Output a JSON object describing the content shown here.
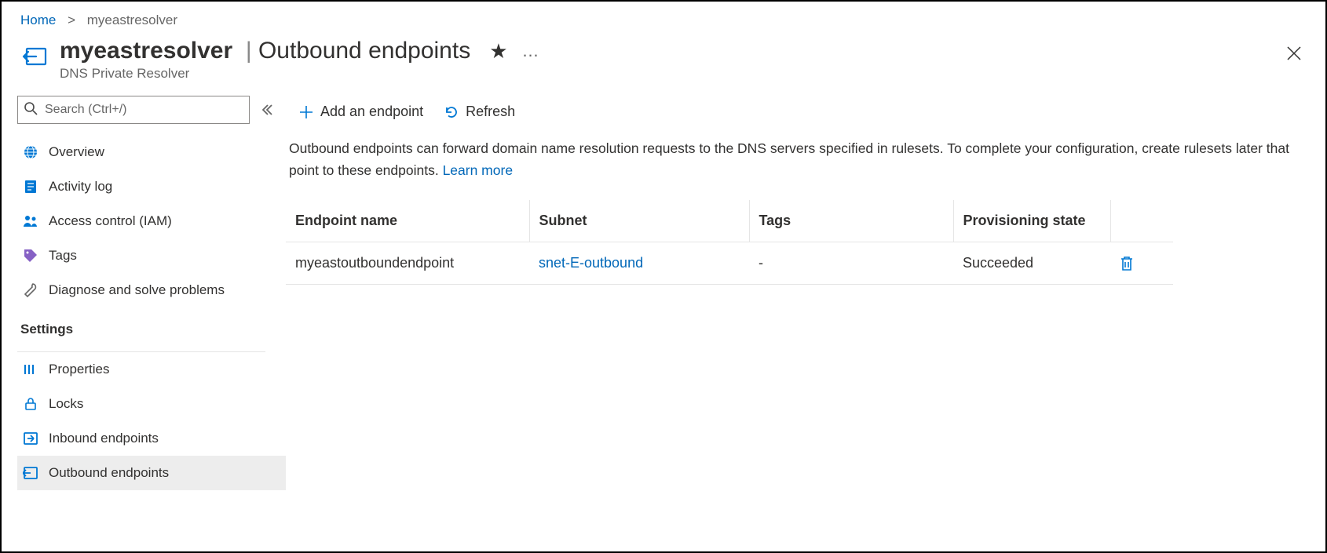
{
  "breadcrumb": {
    "home": "Home",
    "current": "myeastresolver"
  },
  "header": {
    "resource_name": "myeastresolver",
    "page_name": "Outbound endpoints",
    "subtitle": "DNS Private Resolver"
  },
  "search": {
    "placeholder": "Search (Ctrl+/)"
  },
  "nav": {
    "overview": "Overview",
    "activity_log": "Activity log",
    "access_control": "Access control (IAM)",
    "tags": "Tags",
    "diagnose": "Diagnose and solve problems",
    "section_settings": "Settings",
    "properties": "Properties",
    "locks": "Locks",
    "inbound": "Inbound endpoints",
    "outbound": "Outbound endpoints"
  },
  "toolbar": {
    "add": "Add an endpoint",
    "refresh": "Refresh"
  },
  "description": {
    "text": "Outbound endpoints can forward domain name resolution requests to the DNS servers specified in rulesets. To complete your configuration, create rulesets later that point to these endpoints. ",
    "learn_more": "Learn more"
  },
  "table": {
    "headers": {
      "name": "Endpoint name",
      "subnet": "Subnet",
      "tags": "Tags",
      "state": "Provisioning state"
    },
    "rows": [
      {
        "name": "myeastoutboundendpoint",
        "subnet": "snet-E-outbound",
        "tags": "-",
        "state": "Succeeded"
      }
    ]
  }
}
